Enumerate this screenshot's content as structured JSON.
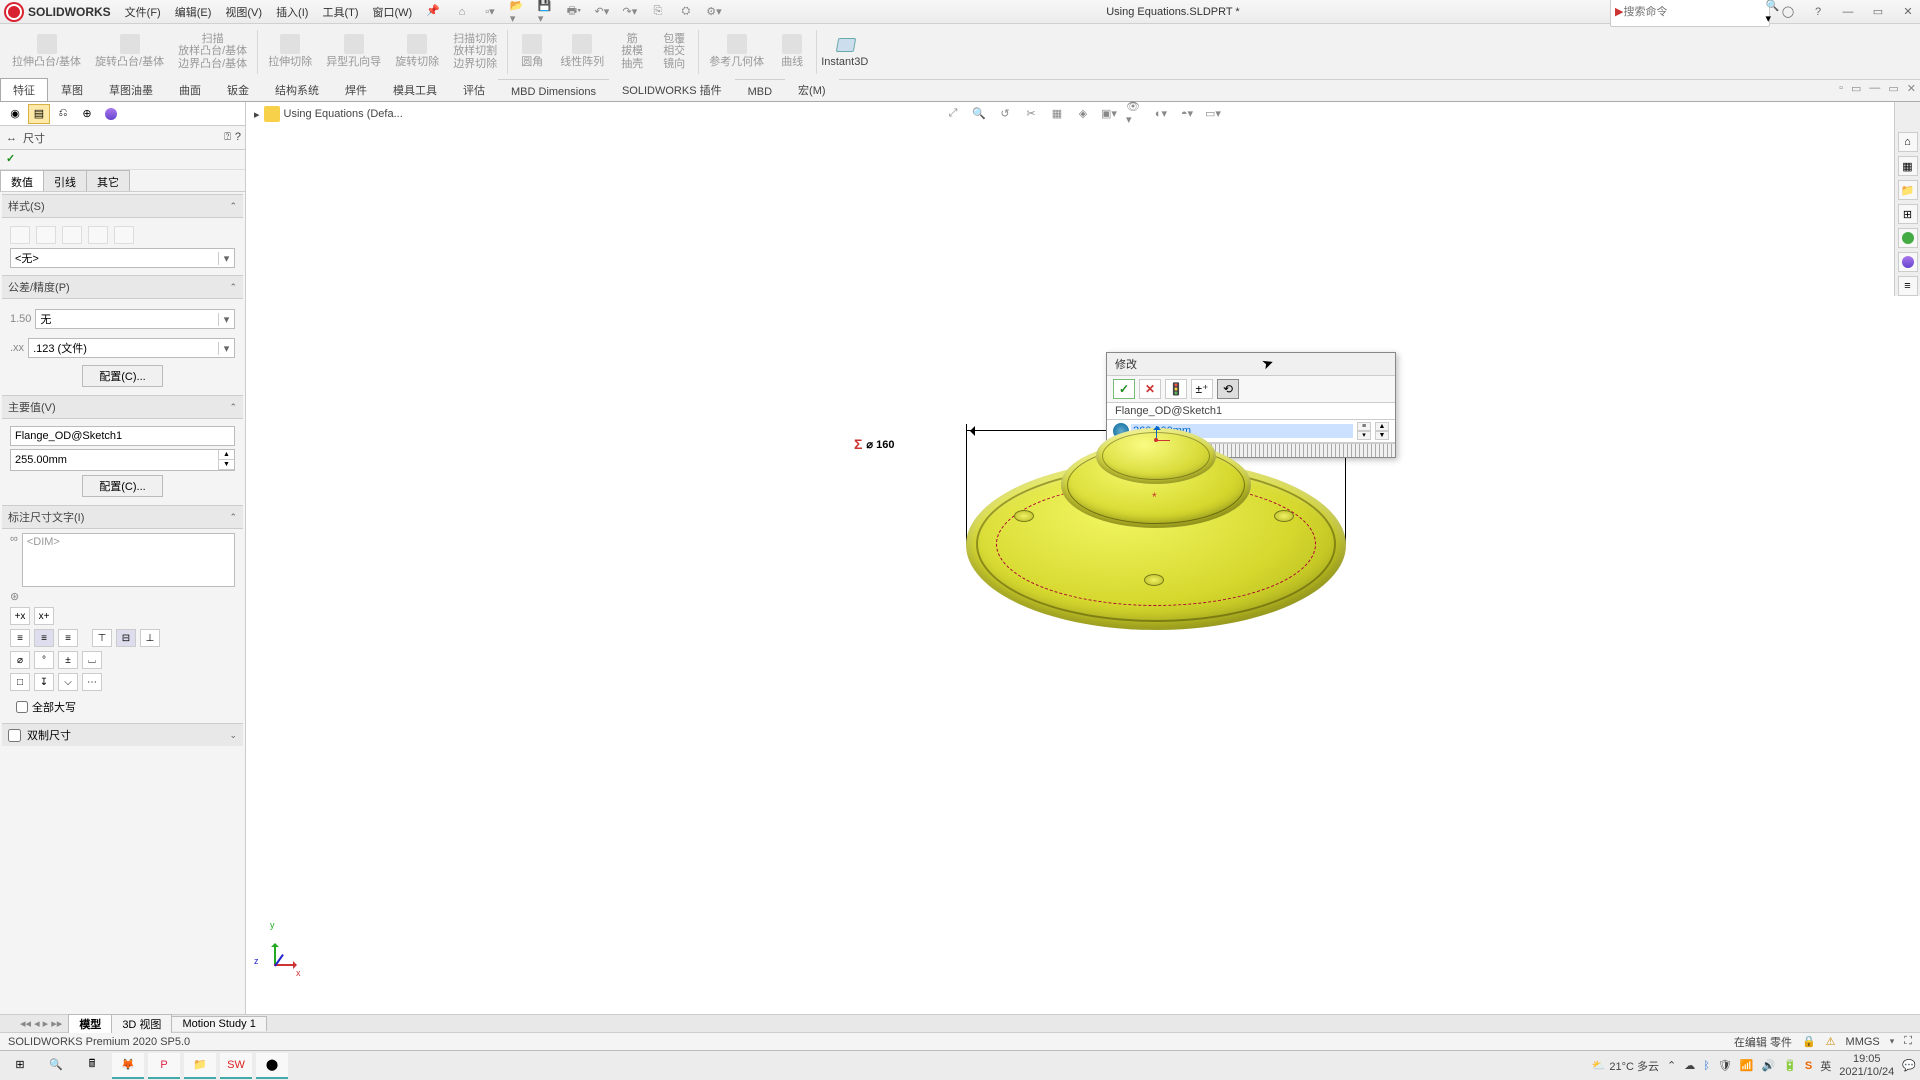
{
  "app": {
    "name": "SOLIDWORKS",
    "doc_title": "Using Equations.SLDPRT *"
  },
  "menus": [
    "文件(F)",
    "编辑(E)",
    "视图(V)",
    "插入(I)",
    "工具(T)",
    "窗口(W)"
  ],
  "search": {
    "placeholder": "搜索命令"
  },
  "ribbon": {
    "groups": [
      "拉伸凸台/基体",
      "旋转凸台/基体",
      "扫描",
      "放样凸台/基体",
      "边界凸台/基体",
      "拉伸切除",
      "异型孔向导",
      "旋转切除",
      "扫描切除",
      "放样切割",
      "边界切除",
      "圆角",
      "线性阵列",
      "筋",
      "拔模",
      "抽壳",
      "包覆",
      "相交",
      "镜向",
      "参考几何体",
      "曲线"
    ],
    "instant3d": "Instant3D"
  },
  "tabs": [
    "特征",
    "草图",
    "草图油墨",
    "曲面",
    "钣金",
    "结构系统",
    "焊件",
    "模具工具",
    "评估",
    "MBD Dimensions",
    "SOLIDWORKS 插件",
    "MBD",
    "宏(M)"
  ],
  "breadcrumb": "Using Equations  (Defa...",
  "prop": {
    "title": "尺寸",
    "tabs": [
      "数值",
      "引线",
      "其它"
    ],
    "section_style": "样式(S)",
    "style_none": "<无>",
    "section_tol": "公差/精度(P)",
    "tol_none": "无",
    "tol_prec": ".123 (文件)",
    "btn_config": "配置(C)...",
    "section_primary": "主要值(V)",
    "primary_name": "Flange_OD@Sketch1",
    "primary_val": "255.00mm",
    "section_dimtext": "标注尺寸文字(I)",
    "dimtext_placeholder": "<DIM>",
    "check_caps": "全部大写",
    "section_dual": "双制尺寸"
  },
  "dimension": {
    "sigma": "Σ",
    "label": "⌀ 160"
  },
  "modify": {
    "title": "修改",
    "name": "Flange_OD@Sketch1",
    "value": "260.000mm"
  },
  "triad": {
    "x": "x",
    "y": "y",
    "z": "z"
  },
  "bottom_tabs": [
    "模型",
    "3D 视图",
    "Motion Study 1"
  ],
  "status": {
    "left": "SOLIDWORKS Premium 2020 SP5.0",
    "right_mode": "在编辑 零件",
    "units": "MMGS"
  },
  "taskbar": {
    "weather": "21°C 多云",
    "time": "19:05",
    "date": "2021/10/24"
  }
}
